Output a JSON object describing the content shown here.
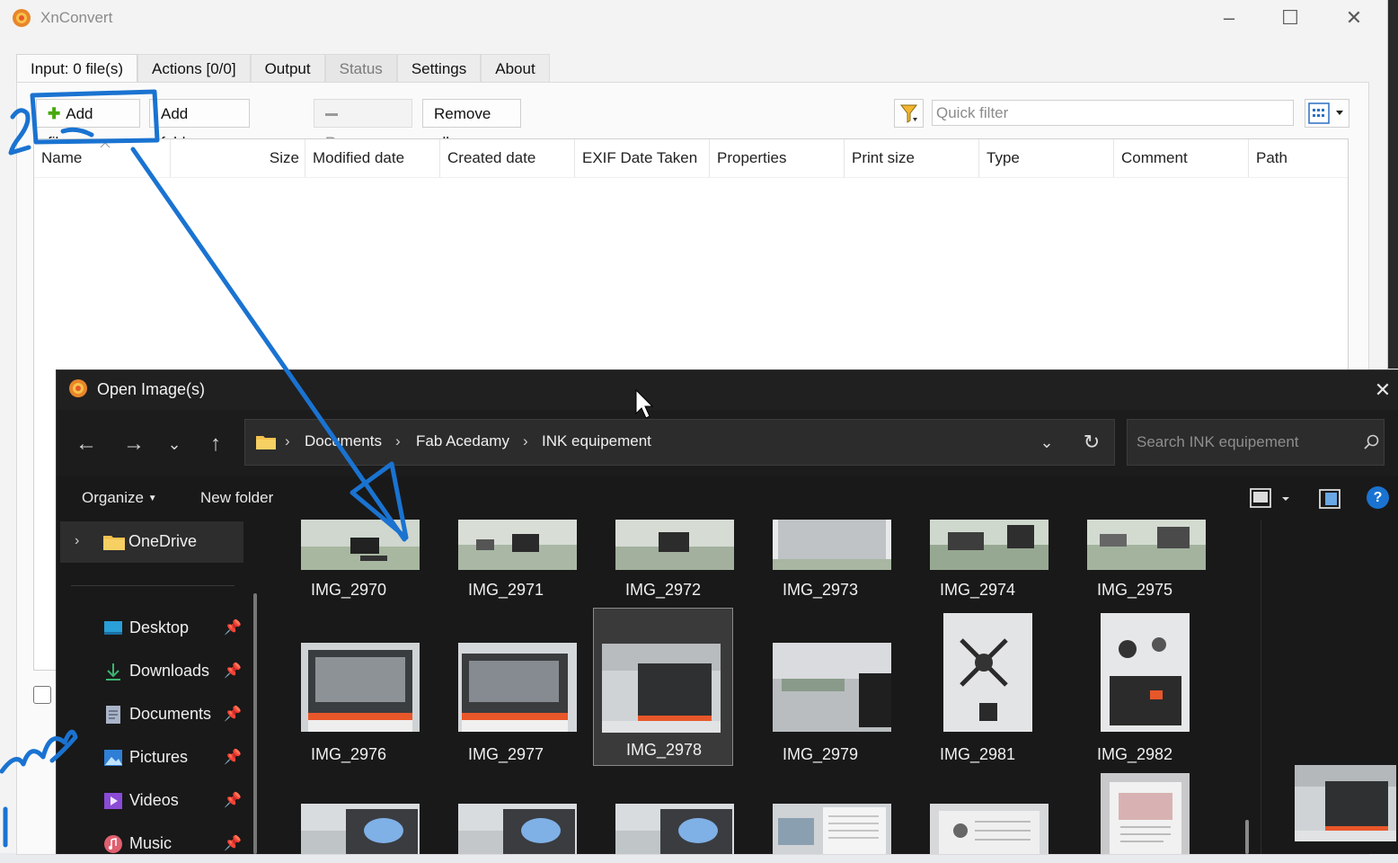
{
  "window": {
    "title": "XnConvert",
    "controls": {
      "minimize": "–",
      "maximize": "☐",
      "close": "✕"
    }
  },
  "tabs": [
    {
      "label": "Input: 0 file(s)",
      "active": true
    },
    {
      "label": "Actions [0/0]"
    },
    {
      "label": "Output"
    },
    {
      "label": "Status",
      "disabled": true
    },
    {
      "label": "Settings"
    },
    {
      "label": "About"
    }
  ],
  "toolbar": {
    "add_files": "Add files...",
    "add_folder": "Add folder...",
    "remove": "Remove",
    "remove_all": "Remove all",
    "quick_filter_placeholder": "Quick filter"
  },
  "file_list": {
    "columns": [
      "Name",
      "Size",
      "Modified date",
      "Created date",
      "EXIF Date Taken",
      "Properties",
      "Print size",
      "Type",
      "Comment",
      "Path"
    ]
  },
  "dialog": {
    "title": "Open Image(s)",
    "breadcrumb": [
      "Documents",
      "Fab Acedamy",
      "INK equipement"
    ],
    "search_placeholder": "Search INK equipement",
    "commands": {
      "organize": "Organize",
      "new_folder": "New folder",
      "help": "?"
    },
    "nav_pane": {
      "onedrive": "OneDrive",
      "quick_access": [
        {
          "label": "Desktop",
          "icon": "desktop-icon",
          "color": "#2a9fd8"
        },
        {
          "label": "Downloads",
          "icon": "download-icon",
          "color": "#3cb371"
        },
        {
          "label": "Documents",
          "icon": "documents-icon",
          "color": "#aab4c8"
        },
        {
          "label": "Pictures",
          "icon": "pictures-icon",
          "color": "#2f7fd6"
        },
        {
          "label": "Videos",
          "icon": "videos-icon",
          "color": "#8a4bd6"
        },
        {
          "label": "Music",
          "icon": "music-icon",
          "color": "#e06070"
        }
      ]
    },
    "files_row1": [
      "IMG_2970",
      "IMG_2971",
      "IMG_2972",
      "IMG_2973",
      "IMG_2974",
      "IMG_2975"
    ],
    "files_row2": [
      "IMG_2976",
      "IMG_2977",
      "IMG_2978",
      "IMG_2979",
      "IMG_2981",
      "IMG_2982"
    ],
    "selected_file": "IMG_2978"
  },
  "colors": {
    "annotation_blue": "#1a73d1",
    "dialog_bg": "#191919",
    "accent_orange": "#e8572a"
  }
}
